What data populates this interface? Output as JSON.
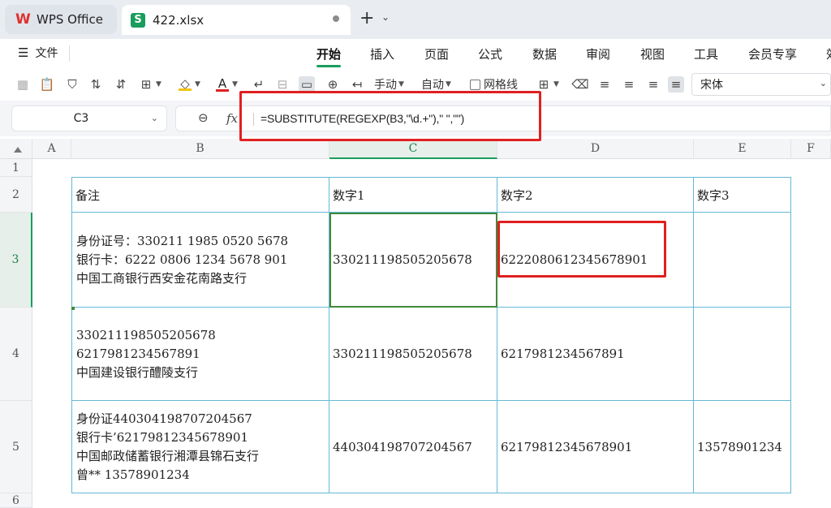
{
  "tabs": {
    "app_label": "WPS Office",
    "file_label": "422.xlsx",
    "file_icon_letter": "S",
    "add_label": "+",
    "add_chevron": "⌄"
  },
  "menu": {
    "file_label": "文件",
    "items": [
      "开始",
      "插入",
      "页面",
      "公式",
      "数据",
      "审阅",
      "视图",
      "工具",
      "会员专享",
      "效"
    ],
    "active_index": 0
  },
  "toolbar": {
    "manual_label": "手动",
    "auto_label": "自动",
    "gridlines_label": "网格线",
    "font_name": "宋体",
    "font_color": "#e02020",
    "fill_color": "#f3c316"
  },
  "formula_bar": {
    "cell_ref": "C3",
    "fx_label": "fx",
    "formula": "=SUBSTITUTE(REGEXP(B3,\"\\d.+\"),\" \",\"\")"
  },
  "grid": {
    "columns": [
      "A",
      "B",
      "C",
      "D",
      "E",
      "F"
    ],
    "selected_column": "C",
    "rows": [
      "1",
      "2",
      "3",
      "4",
      "5",
      "6"
    ],
    "selected_row": "3",
    "header_row": [
      "备注",
      "数字1",
      "数字2",
      "数字3"
    ],
    "data_rows": [
      {
        "note": [
          "身份证号：330211 1985 0520 5678",
          "银行卡：6222 0806 1234 5678 901",
          "中国工商银行西安金花南路支行"
        ],
        "num1": "330211198505205678",
        "num2": "6222080612345678901",
        "num3": ""
      },
      {
        "note": [
          "330211198505205678",
          "6217981234567891",
          "中国建设银行醴陵支行"
        ],
        "num1": "330211198505205678",
        "num2": "6217981234567891",
        "num3": ""
      },
      {
        "note": [
          "身份证440304198707204567",
          "银行卡’62179812345678901",
          "中国邮政储蓄银行湘潭县锦石支行",
          "曾** 13578901234"
        ],
        "num1": "440304198707204567",
        "num2": "62179812345678901",
        "num3": "13578901234"
      }
    ]
  },
  "colors": {
    "accent": "#1a9d5d",
    "annotation_red": "#e02020",
    "table_border": "#65b9d6",
    "selection_border": "#3f8a3a"
  }
}
